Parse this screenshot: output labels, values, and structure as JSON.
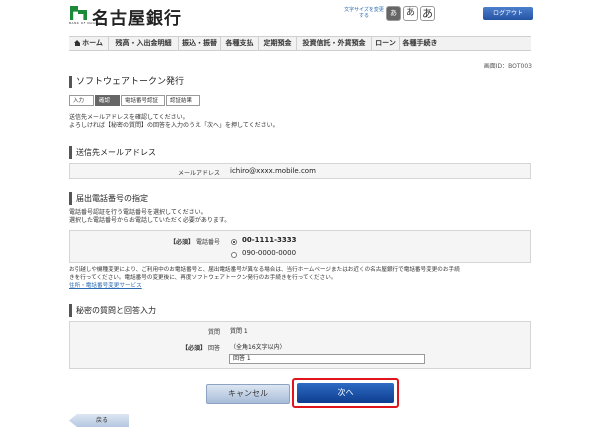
{
  "header": {
    "bank_name": "名古屋銀行",
    "logo_sub": "BANK OF NAGOYA",
    "font_size_label": "文字サイズを変更する",
    "font_sizes": [
      "あ",
      "あ",
      "あ"
    ],
    "logout": "ログアウト"
  },
  "nav": {
    "items": [
      "ホーム",
      "残高・入出金明細",
      "振込・振替",
      "各種支払",
      "定期預金",
      "投資信託・外貨預金",
      "ローン",
      "各種手続き"
    ]
  },
  "screen_id": "画面ID：BOT003",
  "page_title": "ソフトウェアトークン発行",
  "steps": [
    "入力",
    "確認",
    "電話番号認証",
    "認証結果"
  ],
  "active_step": 1,
  "intro": {
    "line1": "送信先メールアドレスを確認してください。",
    "line2": "よろしければ【秘密の質問】の回答を入力のうえ「次へ」を押してください。"
  },
  "email_section": {
    "title": "送信先メールアドレス",
    "label": "メールアドレス",
    "value": "ichiro@xxxx.mobile.com"
  },
  "phone_section": {
    "title": "届出電話番号の指定",
    "desc1": "電話番号認証を行う電話番号を選択してください。",
    "desc2": "選択した電話番号からお電話していただく必要があります。",
    "required": "【必須】",
    "label": "電話番号",
    "options": [
      "00-1111-3333",
      "090-0000-0000"
    ],
    "selected": 0,
    "note1": "お引越しや機種変更により、ご利用中のお電話番号と、届出電話番号が異なる場合は、当行ホームページまたはお近くの名古屋銀行で電話番号変更のお手続",
    "note2": "きを行ってください。電話番号の変更後に、再度ソフトウェアトークン発行のお手続きを行ってください。",
    "link": "住所・電話番号変更サービス"
  },
  "secret_section": {
    "title": "秘密の質問と回答入力",
    "question_label": "質問",
    "question_value": "質問 1",
    "required": "【必須】",
    "answer_label": "回答",
    "answer_hint": "（全角16文字以内）",
    "answer_value": "回答 1"
  },
  "buttons": {
    "cancel": "キャンセル",
    "next": "次へ",
    "back": "戻る"
  },
  "colors": {
    "brand_green": "#1d8a3b",
    "primary_blue": "#1a4fa6",
    "highlight_red": "#e0141c"
  }
}
